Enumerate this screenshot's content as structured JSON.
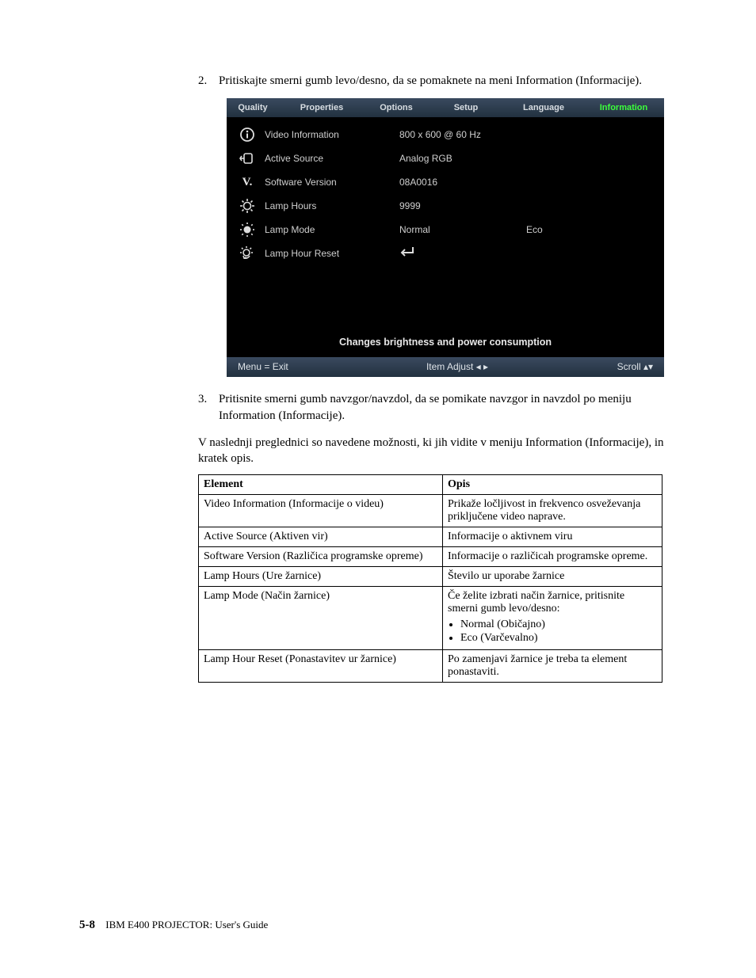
{
  "step2": {
    "num": "2.",
    "text": "Pritiskajte smerni gumb levo/desno, da se pomaknete na meni Information (Informacije)."
  },
  "step3": {
    "num": "3.",
    "text": "Pritisnite smerni gumb navzgor/navzdol, da se pomikate navzgor in navzdol po meniju Information (Informacije)."
  },
  "para_intro": "V naslednji preglednici so navedene možnosti, ki jih vidite v meniju Information (Informacije), in kratek opis.",
  "osd": {
    "tabs": [
      "Quality",
      "Properties",
      "Options",
      "Setup",
      "Language",
      "Information"
    ],
    "rows": [
      {
        "icon": "info",
        "label": "Video Information",
        "val": "800  x  600  @  60 Hz",
        "val2": ""
      },
      {
        "icon": "source",
        "label": "Active Source",
        "val": "Analog RGB",
        "val2": ""
      },
      {
        "icon": "v",
        "label": "Software Version",
        "val": "08A0016",
        "val2": ""
      },
      {
        "icon": "lamp",
        "label": "Lamp Hours",
        "val": "9999",
        "val2": ""
      },
      {
        "icon": "mode",
        "label": "Lamp Mode",
        "val": "Normal",
        "val2": "Eco"
      },
      {
        "icon": "reset",
        "label": "Lamp Hour Reset",
        "val": "↵",
        "val2": ""
      }
    ],
    "desc": "Changes brightness and power consumption",
    "foot_left": "Menu = Exit",
    "foot_mid": "Item Adjust  ◂ ▸",
    "foot_right": "Scroll  ▴▾"
  },
  "table": {
    "head": {
      "c1": "Element",
      "c2": "Opis"
    },
    "rows": [
      {
        "c1": "Video Information (Informacije o videu)",
        "c2": "Prikaže ločljivost in frekvenco osveževanja priključene video naprave."
      },
      {
        "c1": "Active Source (Aktiven vir)",
        "c2": "Informacije o aktivnem viru"
      },
      {
        "c1": "Software Version (Različica programske opreme)",
        "c2": "Informacije o različicah programske opreme."
      },
      {
        "c1": "Lamp Hours (Ure žarnice)",
        "c2": "Število ur uporabe žarnice"
      },
      {
        "c1": "Lamp Mode (Način žarnice)",
        "c2_intro": "Če želite izbrati način žarnice, pritisnite smerni gumb levo/desno:",
        "c2_list": [
          "Normal (Običajno)",
          "Eco (Varčevalno)"
        ]
      },
      {
        "c1": "Lamp Hour Reset (Ponastavitev ur žarnice)",
        "c2": "Po zamenjavi žarnice je treba ta element ponastaviti."
      }
    ]
  },
  "footer": {
    "page": "5-8",
    "title": "IBM E400 PROJECTOR: User's Guide"
  }
}
